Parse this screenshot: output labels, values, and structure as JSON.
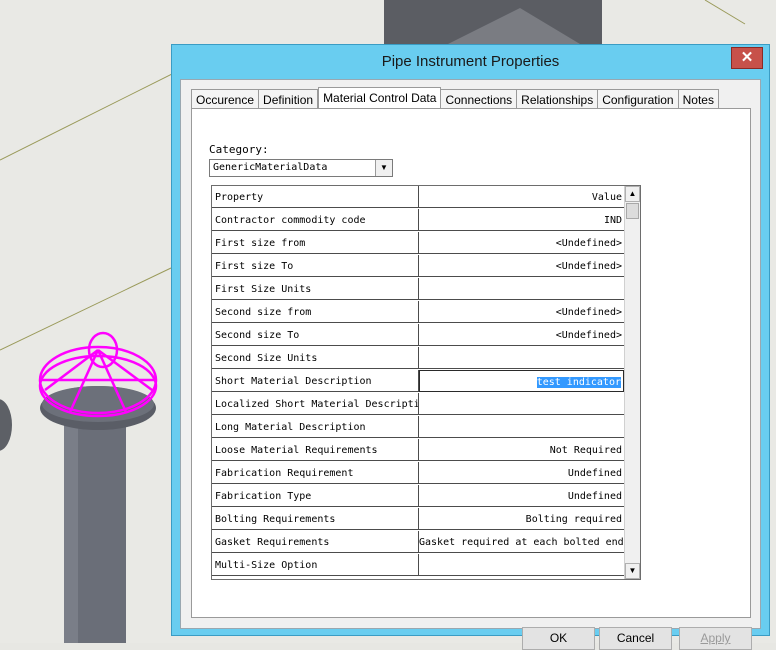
{
  "dialog": {
    "title": "Pipe Instrument Properties",
    "close_glyph": "✕"
  },
  "tabs": [
    {
      "label": "Occurence"
    },
    {
      "label": "Definition"
    },
    {
      "label": "Material Control Data"
    },
    {
      "label": "Connections"
    },
    {
      "label": "Relationships"
    },
    {
      "label": "Configuration"
    },
    {
      "label": "Notes"
    }
  ],
  "active_tab": "Material Control Data",
  "category": {
    "label": "Category:",
    "value": "GenericMaterialData"
  },
  "grid": {
    "header": {
      "property": "Property",
      "value": "Value"
    },
    "rows": [
      {
        "property": "Contractor commodity code",
        "value": "IND"
      },
      {
        "property": "First size from",
        "value": "<Undefined>"
      },
      {
        "property": "First size To",
        "value": "<Undefined>"
      },
      {
        "property": "First Size Units",
        "value": ""
      },
      {
        "property": "Second size from",
        "value": "<Undefined>"
      },
      {
        "property": "Second size To",
        "value": "<Undefined>"
      },
      {
        "property": "Second Size Units",
        "value": ""
      },
      {
        "property": "Short Material Description",
        "value": "test indicator"
      },
      {
        "property": "Localized Short Material Descripti",
        "value": ""
      },
      {
        "property": "Long Material Description",
        "value": ""
      },
      {
        "property": "Loose Material Requirements",
        "value": "Not Required"
      },
      {
        "property": "Fabrication Requirement",
        "value": "Undefined"
      },
      {
        "property": "Fabrication Type",
        "value": "Undefined"
      },
      {
        "property": "Bolting Requirements",
        "value": "Bolting required"
      },
      {
        "property": "Gasket Requirements",
        "value": "Gasket required at each bolted end"
      },
      {
        "property": "Multi-Size Option",
        "value": ""
      }
    ]
  },
  "buttons": {
    "ok": "OK",
    "cancel": "Cancel",
    "apply": "Apply"
  },
  "colors": {
    "title_bar": "#69cdf0",
    "close_button": "#c7514a",
    "selection": "#3399ff",
    "instrument_highlight": "#ff00ff"
  }
}
